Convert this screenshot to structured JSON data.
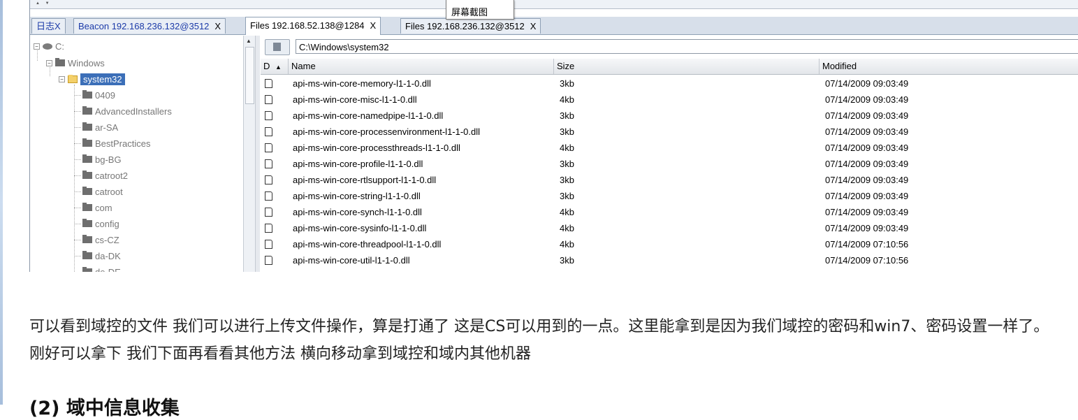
{
  "popup": {
    "label": "屏幕截图"
  },
  "tabs": [
    {
      "label": "日志",
      "close": "X"
    },
    {
      "label": "Beacon 192.168.236.132@3512",
      "close": "X"
    },
    {
      "label": "Files 192.168.52.138@1284",
      "close": "X"
    },
    {
      "label": "Files 192.168.236.132@3512",
      "close": "X"
    }
  ],
  "tree": {
    "drive": "C:",
    "windows": "Windows",
    "system32": "system32",
    "children": [
      "0409",
      "AdvancedInstallers",
      "ar-SA",
      "BestPractices",
      "bg-BG",
      "catroot2",
      "catroot",
      "com",
      "config",
      "cs-CZ",
      "da-DK",
      "de-DE"
    ]
  },
  "path": {
    "value": "C:\\Windows\\system32"
  },
  "table": {
    "headers": {
      "d": "D",
      "sort": "▲",
      "name": "Name",
      "size": "Size",
      "modified": "Modified"
    },
    "rows": [
      {
        "name": "api-ms-win-core-memory-l1-1-0.dll",
        "size": "3kb",
        "modified": "07/14/2009 09:03:49"
      },
      {
        "name": "api-ms-win-core-misc-l1-1-0.dll",
        "size": "4kb",
        "modified": "07/14/2009 09:03:49"
      },
      {
        "name": "api-ms-win-core-namedpipe-l1-1-0.dll",
        "size": "3kb",
        "modified": "07/14/2009 09:03:49"
      },
      {
        "name": "api-ms-win-core-processenvironment-l1-1-0.dll",
        "size": "3kb",
        "modified": "07/14/2009 09:03:49"
      },
      {
        "name": "api-ms-win-core-processthreads-l1-1-0.dll",
        "size": "4kb",
        "modified": "07/14/2009 09:03:49"
      },
      {
        "name": "api-ms-win-core-profile-l1-1-0.dll",
        "size": "3kb",
        "modified": "07/14/2009 09:03:49"
      },
      {
        "name": "api-ms-win-core-rtlsupport-l1-1-0.dll",
        "size": "3kb",
        "modified": "07/14/2009 09:03:49"
      },
      {
        "name": "api-ms-win-core-string-l1-1-0.dll",
        "size": "3kb",
        "modified": "07/14/2009 09:03:49"
      },
      {
        "name": "api-ms-win-core-synch-l1-1-0.dll",
        "size": "4kb",
        "modified": "07/14/2009 09:03:49"
      },
      {
        "name": "api-ms-win-core-sysinfo-l1-1-0.dll",
        "size": "4kb",
        "modified": "07/14/2009 09:03:49"
      },
      {
        "name": "api-ms-win-core-threadpool-l1-1-0.dll",
        "size": "4kb",
        "modified": "07/14/2009 07:10:56"
      },
      {
        "name": "api-ms-win-core-util-l1-1-0.dll",
        "size": "3kb",
        "modified": "07/14/2009 07:10:56"
      }
    ]
  },
  "article": {
    "paragraph": "可以看到域控的文件 我们可以进行上传文件操作，算是打通了 这是CS可以用到的一点。这里能拿到是因为我们域控的密码和win7、密码设置一样了。刚好可以拿下 我们下面再看看其他方法 横向移动拿到域控和域内其他机器",
    "heading": "(2) 域中信息收集"
  }
}
